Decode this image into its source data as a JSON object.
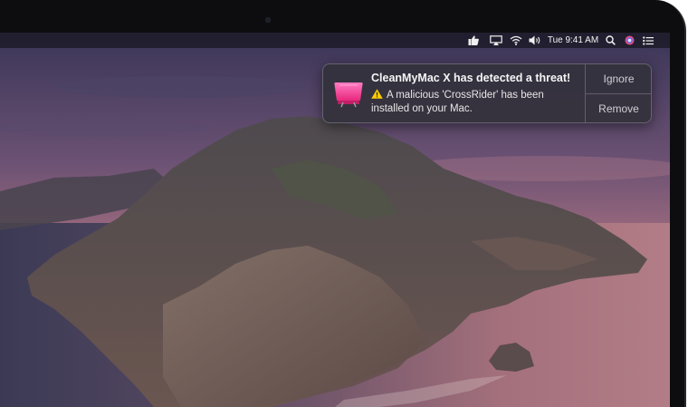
{
  "menubar": {
    "icons": [
      "thumbs-up-icon",
      "airplay-icon",
      "wifi-icon",
      "volume-icon",
      "search-icon",
      "siri-icon",
      "control-center-icon"
    ],
    "clock": "Tue 9:41 AM"
  },
  "notification": {
    "app": "CleanMyMac X",
    "title": "CleanMyMac X has detected a threat!",
    "message": "A malicious 'CrossRider' has been installed on your Mac.",
    "icons": {
      "app": "cleanmymac-app-icon",
      "warning": "warning-icon"
    },
    "actions": {
      "ignore": "Ignore",
      "remove": "Remove"
    }
  },
  "colors": {
    "app_icon_pink": "#ff4fa0",
    "warning_yellow": "#ffcc00",
    "notification_bg": "#34323c"
  }
}
